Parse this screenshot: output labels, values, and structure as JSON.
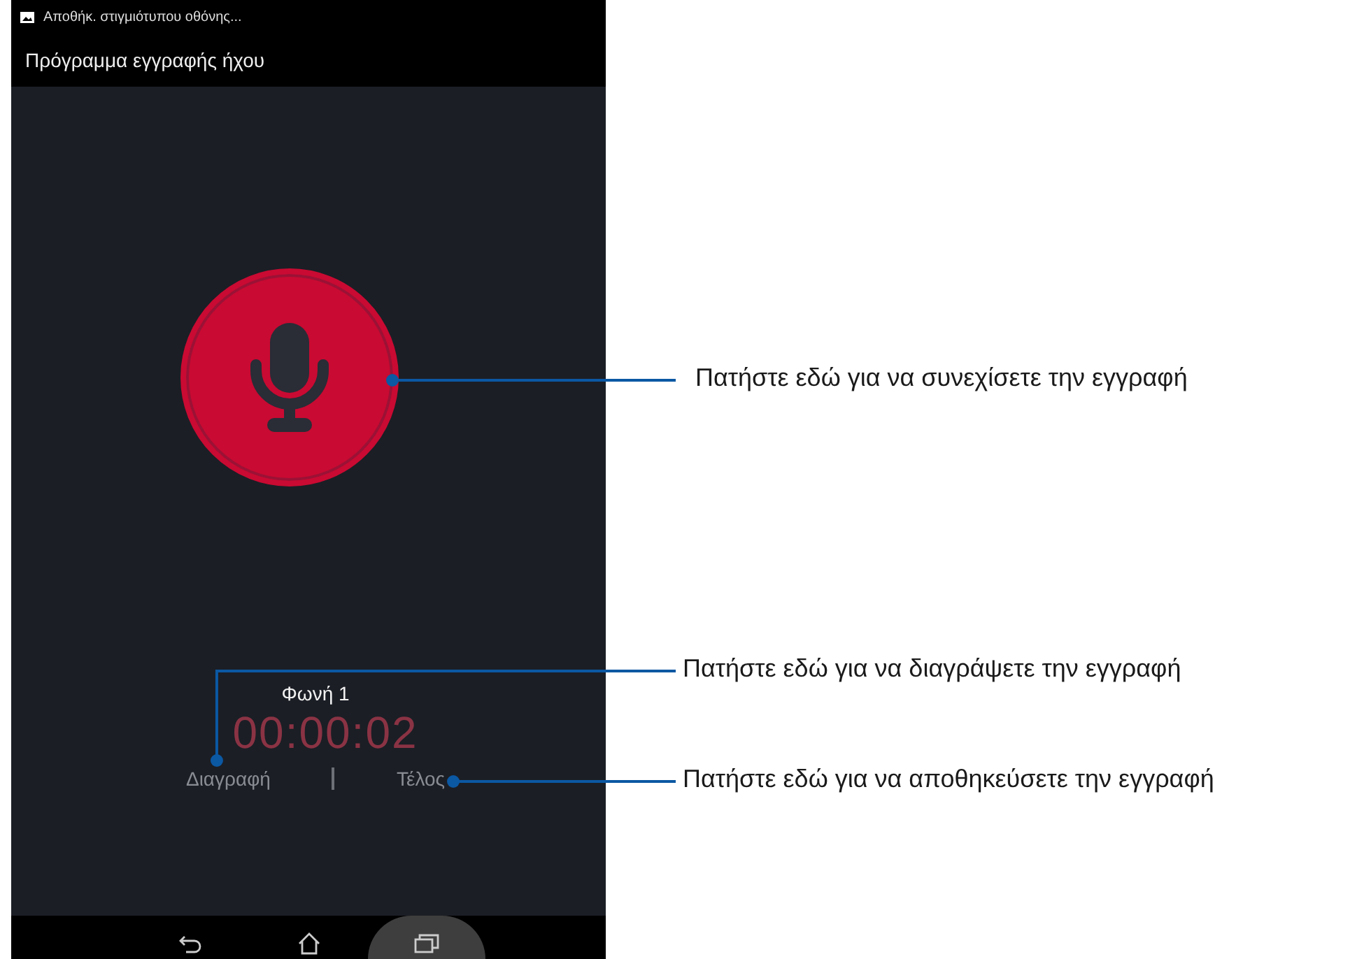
{
  "status_bar": {
    "notification": "Αποθήκ. στιγμιότυπου οθόνης..."
  },
  "app_bar": {
    "title": "Πρόγραμμα εγγραφής ήχου"
  },
  "recording": {
    "name": "Φωνή 1",
    "timer": "00:00:02"
  },
  "actions": [
    {
      "kind": "delete",
      "label": "Διαγραφή"
    },
    {
      "kind": "done",
      "label": "Τέλος"
    }
  ],
  "nav_bar": [
    {
      "kind": "back",
      "pressed": false
    },
    {
      "kind": "home",
      "pressed": false
    },
    {
      "kind": "recents",
      "pressed": true
    }
  ],
  "callouts": [
    {
      "text": "Πατήστε εδώ για να συνεχίσετε την εγγραφή"
    },
    {
      "text": "Πατήστε εδώ για να διαγράψετε την εγγραφή"
    },
    {
      "text": "Πατήστε εδώ για να αποθηκεύσετε την εγγραφή"
    }
  ]
}
